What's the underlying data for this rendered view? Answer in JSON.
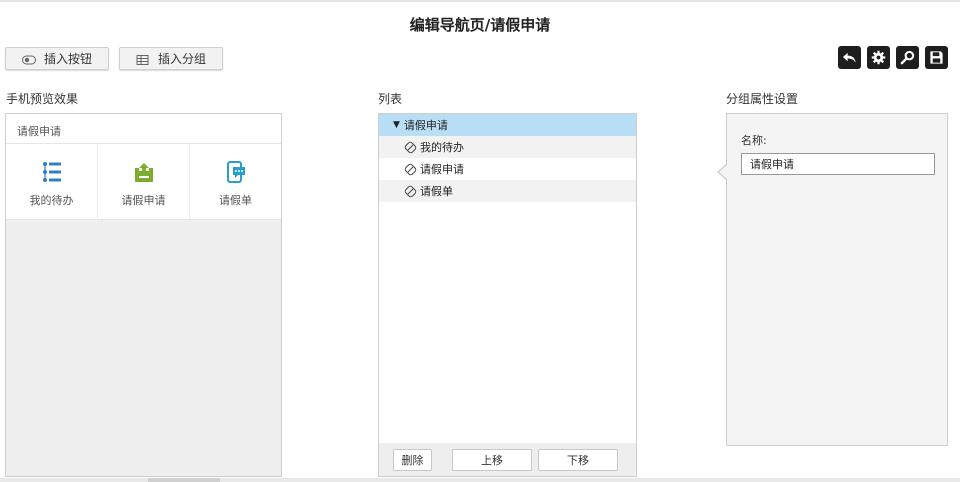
{
  "page": {
    "title": "编辑导航页/请假申请"
  },
  "toolbar": {
    "insert_button_label": "插入按钮",
    "insert_group_label": "插入分组",
    "icons": [
      "back-icon",
      "gear-icon",
      "search-icon",
      "save-icon"
    ]
  },
  "preview": {
    "section_label": "手机预览效果",
    "group_title": "请假申请",
    "items": [
      {
        "label": "我的待办",
        "icon": "list-icon",
        "color": "#2e7fc1"
      },
      {
        "label": "请假申请",
        "icon": "upload-tray-icon",
        "color": "#7cad2f"
      },
      {
        "label": "请假单",
        "icon": "mobile-chat-icon",
        "color": "#2a9fc9"
      }
    ]
  },
  "list": {
    "section_label": "列表",
    "group": "请假申请",
    "children": [
      "我的待办",
      "请假申请",
      "请假单"
    ],
    "delete_label": "删除",
    "up_label": "上移",
    "down_label": "下移",
    "selected_color": "#b9dff7"
  },
  "props": {
    "section_label": "分组属性设置",
    "name_label": "名称:",
    "name_value": "请假申请"
  }
}
